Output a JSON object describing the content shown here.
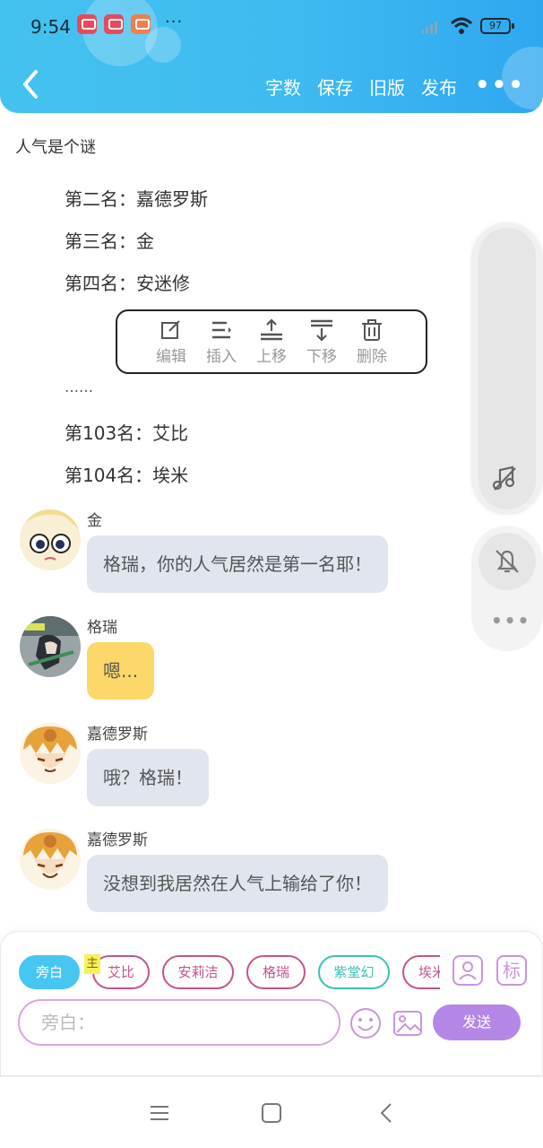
{
  "status_bar": {
    "time": "9:54",
    "battery": "97",
    "overflow": "···"
  },
  "nav": {
    "actions": [
      "字数",
      "保存",
      "旧版",
      "发布"
    ],
    "more": "•••"
  },
  "document": {
    "title": "人气是个谜",
    "lines": [
      "第二名：嘉德罗斯",
      "第三名：金",
      "第四名：安迷修",
      "……",
      "第103名：艾比",
      "第104名：埃米"
    ]
  },
  "toolbar": {
    "items": [
      "编辑",
      "插入",
      "上移",
      "下移",
      "删除"
    ]
  },
  "chat": [
    {
      "sender": "金",
      "text": "格瑞，你的人气居然是第一名耶！",
      "style": "grey"
    },
    {
      "sender": "格瑞",
      "text": "嗯...",
      "style": "yellow"
    },
    {
      "sender": "嘉德罗斯",
      "text": "哦？格瑞！",
      "style": "grey"
    },
    {
      "sender": "嘉德罗斯",
      "text": "没想到我居然在人气上输给了你！",
      "style": "grey"
    }
  ],
  "side_panel": {
    "more": "•••"
  },
  "input": {
    "roles": [
      "旁白",
      "艾比",
      "安莉洁",
      "格瑞",
      "紫堂幻",
      "埃米"
    ],
    "main_badge": "主",
    "tag_button": "标",
    "placeholder": "旁白：",
    "send": "发送"
  },
  "colors": {
    "header": "#44c2ef",
    "accent_purple": "#b487e6",
    "chip_pink": "#c2548f",
    "chip_teal": "#3bbfb3",
    "bubble_grey": "#e1e6ee",
    "bubble_yellow": "#fcd86a"
  }
}
